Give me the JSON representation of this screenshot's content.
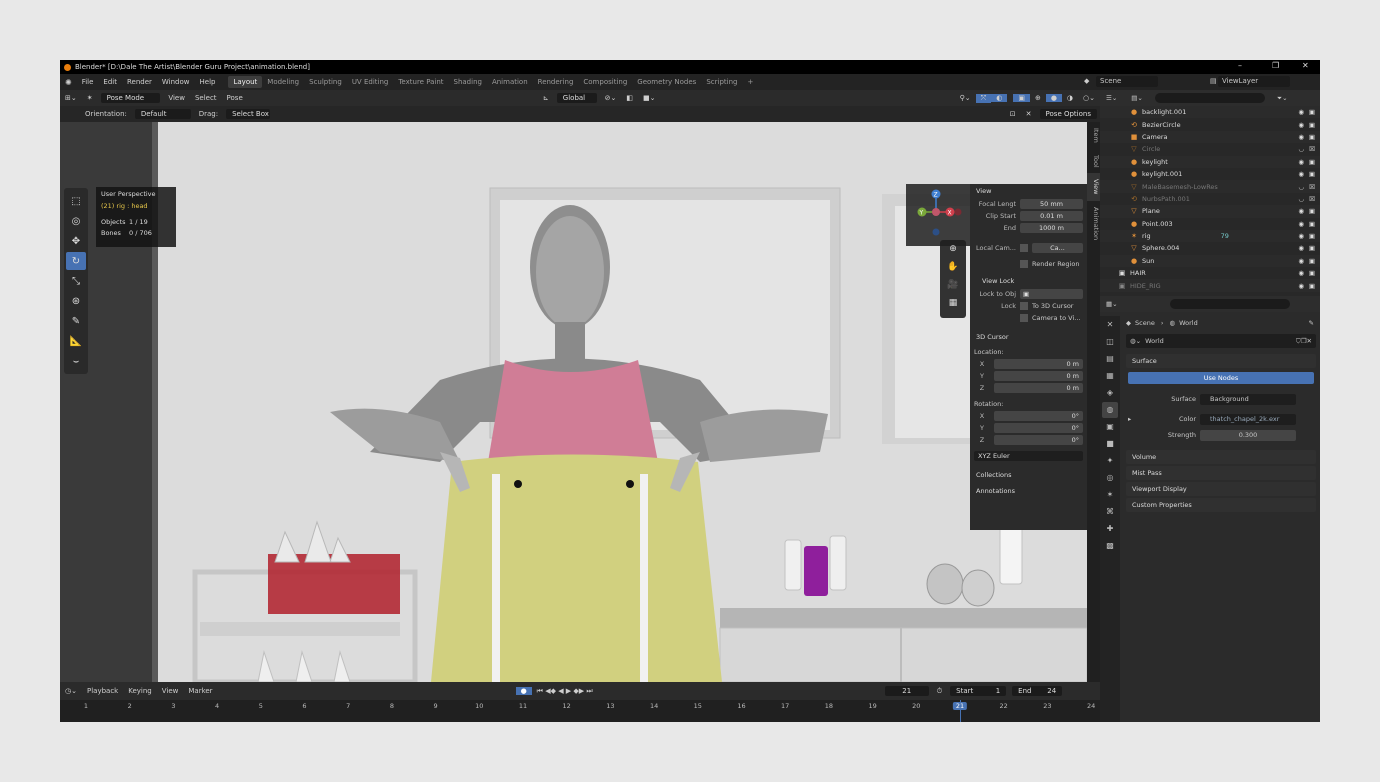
{
  "window": {
    "title": "Blender* [D:\\Dale The Artist\\Blender Guru Project\\animation.blend]",
    "controls": [
      "–",
      "❐",
      "✕"
    ]
  },
  "menu": [
    "File",
    "Edit",
    "Render",
    "Window",
    "Help"
  ],
  "workspaces": [
    "Layout",
    "Modeling",
    "Sculpting",
    "UV Editing",
    "Texture Paint",
    "Shading",
    "Animation",
    "Rendering",
    "Compositing",
    "Geometry Nodes",
    "Scripting"
  ],
  "active_workspace": "Layout",
  "add_workspace": "+",
  "scene_selector": "Scene",
  "viewlayer_selector": "ViewLayer",
  "vp_header": {
    "mode": "Pose Mode",
    "view": "View",
    "select": "Select",
    "pose": "Pose",
    "transform": "Global",
    "pose_options": "Pose Options"
  },
  "vp_header2": {
    "orientation_label": "Orientation:",
    "orientation_value": "Default",
    "drag_label": "Drag:",
    "drag_value": "Select Box"
  },
  "overlay": {
    "view_name": "User Perspective",
    "selection": "(21) rig : head",
    "objects_label": "Objects",
    "objects_value": "1 / 19",
    "bones_label": "Bones",
    "bones_value": "0 / 706"
  },
  "npanel": {
    "view_header": "View",
    "focal_label": "Focal Lengt",
    "focal_value": "50 mm",
    "clip_start_label": "Clip Start",
    "clip_start_value": "0.01 m",
    "clip_end_label": "End",
    "clip_end_value": "1000 m",
    "local_camera_label": "Local Cam...",
    "local_camera_value": "Ca...",
    "render_region": "Render Region",
    "view_lock_header": "View Lock",
    "lock_obj_label": "Lock to Obj",
    "lock_label": "Lock",
    "to_3d_cursor": "To 3D Cursor",
    "camera_to_view": "Camera to Vi...",
    "cursor_header": "3D Cursor",
    "location_label": "Location:",
    "loc_x": "0 m",
    "loc_y": "0 m",
    "loc_z": "0 m",
    "rotation_label": "Rotation:",
    "rot_x": "0°",
    "rot_y": "0°",
    "rot_z": "0°",
    "rot_mode": "XYZ Euler",
    "collections": "Collections",
    "annotations": "Annotations",
    "axis_x": "X",
    "axis_y": "Y",
    "axis_z": "Z"
  },
  "side_tabs": [
    "Item",
    "Tool",
    "View",
    "Animation"
  ],
  "outliner": [
    {
      "name": "backlight.001",
      "icon": "💡",
      "dim": false
    },
    {
      "name": "BezierCircle",
      "icon": "⟲",
      "dim": false
    },
    {
      "name": "Camera",
      "icon": "📷",
      "dim": false
    },
    {
      "name": "Circle",
      "icon": "▽",
      "dim": true
    },
    {
      "name": "keylight",
      "icon": "💡",
      "dim": false
    },
    {
      "name": "keylight.001",
      "icon": "💡",
      "dim": false
    },
    {
      "name": "MaleBasemesh-LowRes",
      "icon": "▽",
      "dim": true
    },
    {
      "name": "NurbsPath.001",
      "icon": "⟲",
      "dim": true
    },
    {
      "name": "Plane",
      "icon": "▽",
      "dim": false
    },
    {
      "name": "Point.003",
      "icon": "💡",
      "dim": false
    },
    {
      "name": "rig",
      "icon": "✶",
      "dim": false
    },
    {
      "name": "Sphere.004",
      "icon": "▽",
      "dim": false
    },
    {
      "name": "Sun",
      "icon": "💡",
      "dim": false
    },
    {
      "name": "HAIR",
      "icon": "▣",
      "dim": false
    },
    {
      "name": "HIDE_RIG",
      "icon": "▣",
      "dim": true
    }
  ],
  "outliner_extra": {
    "rig_count": "79"
  },
  "props": {
    "scene": "Scene",
    "world": "World",
    "world_field": "World",
    "surface_header": "Surface",
    "use_nodes": "Use Nodes",
    "surface_label": "Surface",
    "surface_value": "Background",
    "color_label": "Color",
    "color_value": "thatch_chapel_2k.exr",
    "strength_label": "Strength",
    "strength_value": "0.300",
    "sections": [
      "Volume",
      "Mist Pass",
      "Viewport Display",
      "Custom Properties"
    ]
  },
  "timeline": {
    "playback": "Playback",
    "keying": "Keying",
    "view": "View",
    "marker": "Marker",
    "current": "21",
    "start_label": "Start",
    "start": "1",
    "end_label": "End",
    "end": "24",
    "frames": [
      "1",
      "2",
      "3",
      "4",
      "5",
      "6",
      "7",
      "8",
      "9",
      "10",
      "11",
      "12",
      "13",
      "14",
      "15",
      "16",
      "17",
      "18",
      "19",
      "20",
      "21",
      "22",
      "23",
      "24"
    ]
  },
  "colors": {
    "accent": "#4772b3",
    "top_pink": "#d07d96",
    "pants": "#d1d07f",
    "bottle": "#8f1f9c"
  }
}
